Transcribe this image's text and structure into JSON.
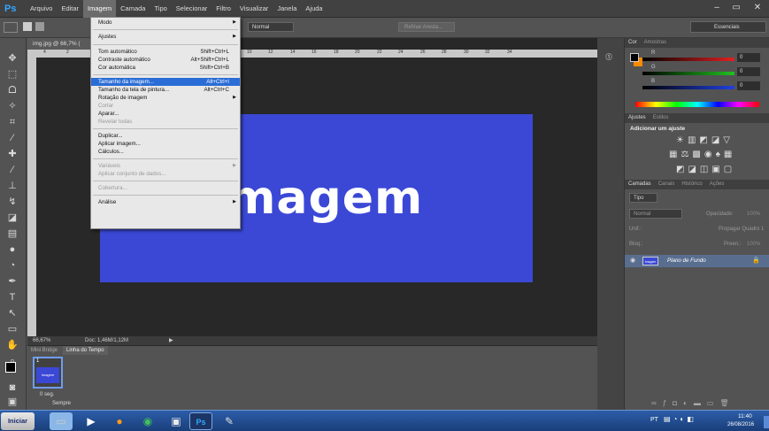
{
  "app": {
    "logo": "Ps"
  },
  "menubar": {
    "items": [
      "Arquivo",
      "Editar",
      "Imagem",
      "Camada",
      "Tipo",
      "Selecionar",
      "Filtro",
      "Visualizar",
      "Janela",
      "Ajuda"
    ]
  },
  "window": {
    "minimize": "–",
    "restore": "▭",
    "close": "✕"
  },
  "optbar": {
    "mode_label": "Normal",
    "refine_label": "Refinar Aresta...",
    "workspace": "Essenciais"
  },
  "document": {
    "tab_title": "img.jpg @ 66,7% (",
    "canvas_text": "Imagem",
    "zoom": "66,67%",
    "doc_info": "Doc: 1,46M/1,12M",
    "bg_color": "#3b48d6"
  },
  "rulers": {
    "h_ticks": [
      "4",
      "2",
      "",
      "10",
      "12",
      "14",
      "16",
      "18",
      "20",
      "22",
      "24",
      "26",
      "28",
      "30",
      "32",
      "34"
    ]
  },
  "image_menu": {
    "items": [
      {
        "label": "Modo",
        "shortcut": "",
        "submenu": true,
        "disabled": false
      },
      {
        "label": "Ajustes",
        "shortcut": "",
        "submenu": true,
        "disabled": false
      },
      {
        "label": "Tom automático",
        "shortcut": "Shift+Ctrl+L",
        "submenu": false,
        "disabled": false
      },
      {
        "label": "Contraste automático",
        "shortcut": "Alt+Shift+Ctrl+L",
        "submenu": false,
        "disabled": false
      },
      {
        "label": "Cor automática",
        "shortcut": "Shift+Ctrl+B",
        "submenu": false,
        "disabled": false
      },
      {
        "label": "Tamanho da imagem...",
        "shortcut": "Alt+Ctrl+I",
        "submenu": false,
        "disabled": false,
        "highlighted": true
      },
      {
        "label": "Tamanho da tela de pintura...",
        "shortcut": "Alt+Ctrl+C",
        "submenu": false,
        "disabled": false
      },
      {
        "label": "Rotação de imagem",
        "shortcut": "",
        "submenu": true,
        "disabled": false
      },
      {
        "label": "Cortar",
        "shortcut": "",
        "submenu": false,
        "disabled": true
      },
      {
        "label": "Aparar...",
        "shortcut": "",
        "submenu": false,
        "disabled": false
      },
      {
        "label": "Revelar todas",
        "shortcut": "",
        "submenu": false,
        "disabled": true
      },
      {
        "label": "Duplicar...",
        "shortcut": "",
        "submenu": false,
        "disabled": false
      },
      {
        "label": "Aplicar imagem...",
        "shortcut": "",
        "submenu": false,
        "disabled": false
      },
      {
        "label": "Cálculos...",
        "shortcut": "",
        "submenu": false,
        "disabled": false
      },
      {
        "label": "Variáveis",
        "shortcut": "",
        "submenu": true,
        "disabled": true
      },
      {
        "label": "Aplicar conjunto de dados...",
        "shortcut": "",
        "submenu": false,
        "disabled": true
      },
      {
        "label": "Cobertura...",
        "shortcut": "",
        "submenu": false,
        "disabled": true
      },
      {
        "label": "Análise",
        "shortcut": "",
        "submenu": true,
        "disabled": false
      }
    ]
  },
  "bottom_panel": {
    "tabs": [
      "Mini Bridge",
      "Linha do Tempo"
    ],
    "frame_num": "1",
    "frame_label": "Imagem",
    "delay": "0 seg.",
    "loop": "Sempre"
  },
  "color_panel": {
    "tabs": [
      "Cor",
      "Amostras"
    ],
    "r": "0",
    "g": "0",
    "b": "0",
    "r_label": "R",
    "g_label": "G",
    "b_label": "B"
  },
  "adjust_panel": {
    "tabs": [
      "Ajustes",
      "Estilos"
    ],
    "heading": "Adicionar um ajuste"
  },
  "layers_panel": {
    "tabs": [
      "Camadas",
      "Canais",
      "Histórico",
      "Ações"
    ],
    "kind": "Tipo",
    "blend": "Normal",
    "opacity_label": "Opacidade:",
    "opacity": "100%",
    "unify_label": "Unif.:",
    "propagate": "Propagar Quadro 1",
    "lock_label": "Bloq.:",
    "fill_label": "Preen.:",
    "fill": "100%",
    "layer_name": "Plano de Fundo",
    "thumb_label": "Imagem"
  },
  "taskbar": {
    "start": "Iniciar",
    "lang": "PT",
    "time": "11:40",
    "date": "26/08/2016"
  },
  "colors": {
    "accent": "#2a6dd6",
    "canvas": "#3b48d6",
    "red": "#e02020",
    "green": "#20c020",
    "blue": "#2040e0",
    "fg_swatch": "#000000",
    "bg_swatch": "#ff8a00"
  }
}
